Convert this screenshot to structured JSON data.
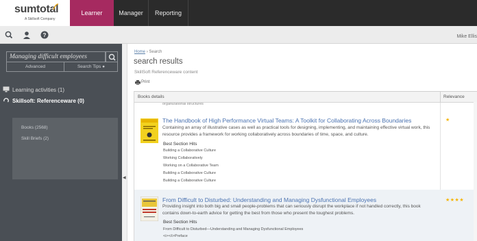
{
  "brand": {
    "name": "sumtotal",
    "tagline": "A Skillsoft Company"
  },
  "nav": {
    "tabs": [
      "Learner",
      "Manager",
      "Reporting"
    ],
    "active": "Learner"
  },
  "user": {
    "name": "Mike Ellis"
  },
  "sidebar": {
    "search_value": "Managing difficult employees",
    "advanced_label": "Advanced",
    "tips_label": "Search Tips",
    "facets": [
      {
        "label": "Learning activities (1)"
      },
      {
        "label": "Skillsoft: Referenceware (0)"
      }
    ],
    "sub_items": [
      "Books (2568)",
      "Skill Briefs (2)"
    ]
  },
  "main": {
    "breadcrumb": {
      "home": "Home",
      "sep": "›",
      "current": "Search"
    },
    "title": "search results",
    "subtitle": "SkillSoft Referenceware content",
    "print_label": "Print",
    "table": {
      "col_details": "Books details",
      "col_relevance": "Relevance",
      "cut_text": "organizational structures"
    },
    "results": [
      {
        "title": "The Handbook of High Performance Virtual Teams: A Toolkit for Collaborating Across Boundaries",
        "description": "Containing an array of illustrative cases as well as practical tools for designing, implementing, and maintaining effective virtual work, this resource provides a framework for working collaboratively across boundaries of time, space, and culture.",
        "hits_label": "Best Section Hits",
        "hits": [
          "Building a Collaborative Culture",
          "Working Collaboratively",
          "Working on a Collaborative Team",
          "Building a Collaborative Culture",
          "Building a Collaborative Culture"
        ],
        "stars": "★",
        "relevance_stars": 1
      },
      {
        "title": "From Difficult to Disturbed: Understanding and Managing Dysfunctional Employees",
        "description": "Providing insight into both big and small people-problems that can seriously disrupt the workplace if not handled correctly, this book contains down-to-earth advice for getting the best from those who present the toughest problems.",
        "hits_label": "Best Section Hits",
        "hits": [
          "From Difficult to Disturbed—Understanding and Managing Dysfunctional Employees",
          "<i></i>Preface"
        ],
        "stars": "★★★★",
        "relevance_stars": 4
      }
    ]
  },
  "colors": {
    "accent": "#a62a60",
    "topbar": "#2b2b2b",
    "sidebar": "#4a4f55",
    "link": "#4a72b0",
    "star": "#f5b400"
  }
}
